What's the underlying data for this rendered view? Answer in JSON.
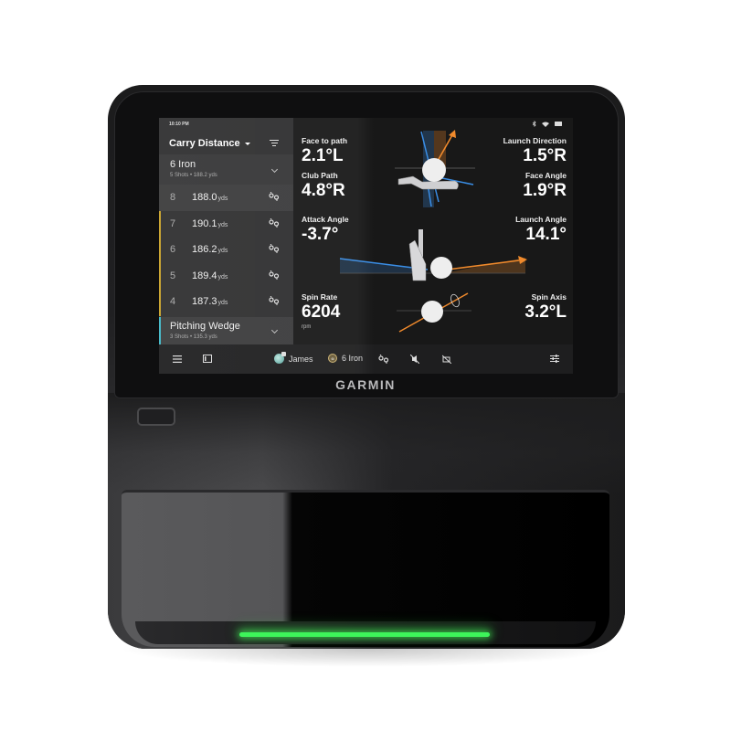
{
  "device": {
    "brand": "GARMIN",
    "light_color": "#3df55a"
  },
  "status_bar": {
    "time": "10:10 PM",
    "icons": [
      "bluetooth-icon",
      "wifi-icon",
      "battery-icon"
    ]
  },
  "left_panel": {
    "title": "Carry Distance",
    "groups": [
      {
        "club": "6 Iron",
        "summary": "5 Shots • 188.2 yds",
        "accent": "#c9a227",
        "shots": [
          {
            "num": "8",
            "value": "188.0",
            "unit": "yds",
            "selected": true
          },
          {
            "num": "7",
            "value": "190.1",
            "unit": "yds",
            "selected": false
          },
          {
            "num": "6",
            "value": "186.2",
            "unit": "yds",
            "selected": false
          },
          {
            "num": "5",
            "value": "189.4",
            "unit": "yds",
            "selected": false
          },
          {
            "num": "4",
            "value": "187.3",
            "unit": "yds",
            "selected": false
          }
        ]
      },
      {
        "club": "Pitching Wedge",
        "summary": "3 Shots • 135.3 yds",
        "accent": "#3fb8c8"
      }
    ]
  },
  "metrics": {
    "face_to_path": {
      "label": "Face to path",
      "value": "2.1°L"
    },
    "club_path": {
      "label": "Club Path",
      "value": "4.8°R"
    },
    "launch_direction": {
      "label": "Launch Direction",
      "value": "1.5°R"
    },
    "face_angle": {
      "label": "Face Angle",
      "value": "1.9°R"
    },
    "attack_angle": {
      "label": "Attack Angle",
      "value": "-3.7°"
    },
    "launch_angle": {
      "label": "Launch Angle",
      "value": "14.1°"
    },
    "spin_rate": {
      "label": "Spin Rate",
      "value": "6204",
      "unit": "rpm"
    },
    "spin_axis": {
      "label": "Spin Axis",
      "value": "3.2°L"
    }
  },
  "bottom_bar": {
    "user": "James",
    "club": "6 Iron",
    "club_badge": "6i"
  },
  "colors": {
    "orange": "#f08a2c",
    "blue": "#3a8ee6",
    "panel": "#2e2e2f",
    "screen": "#181818"
  }
}
